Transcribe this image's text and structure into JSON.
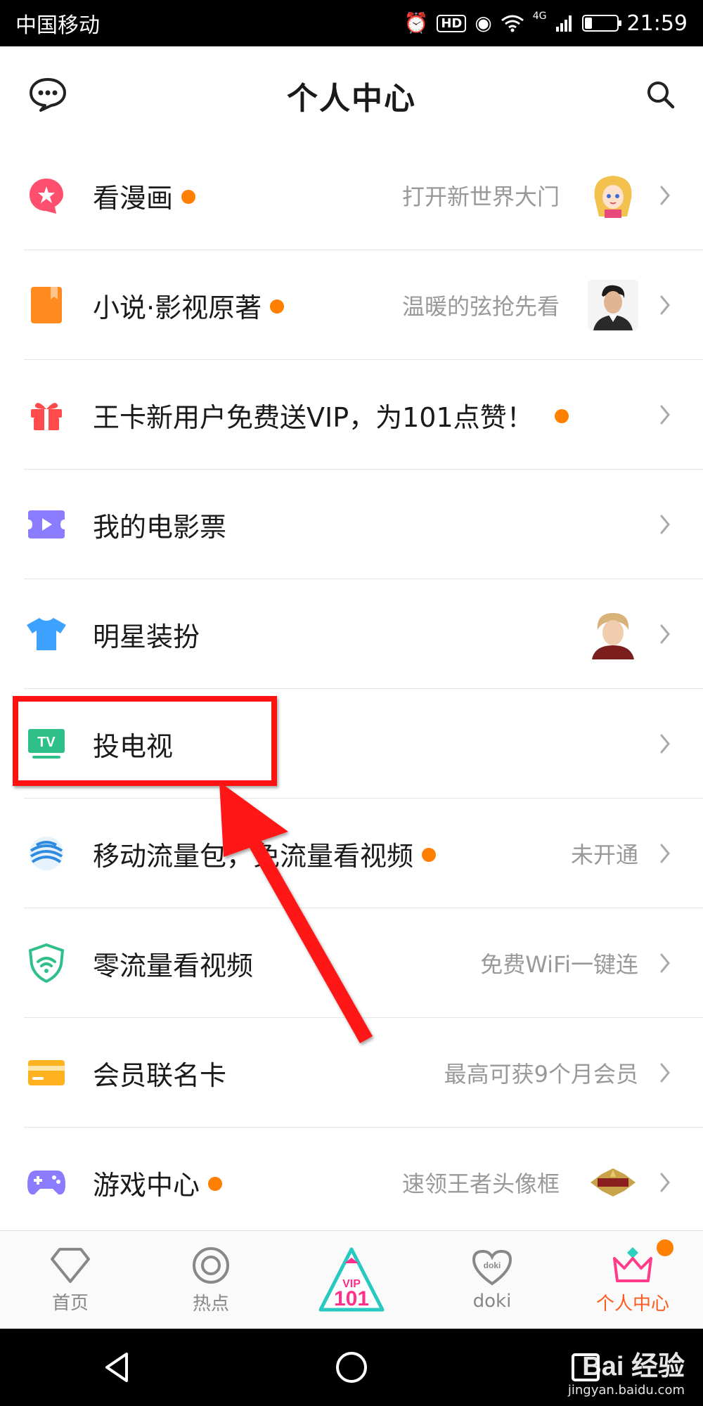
{
  "status_bar": {
    "carrier": "中国移动",
    "hd": "HD",
    "network": "4G",
    "time": "21:59"
  },
  "header": {
    "title": "个人中心",
    "left_icon": "message-icon",
    "right_icon": "search-icon"
  },
  "rows": [
    {
      "title": "看漫画",
      "dot": true,
      "subtitle": "打开新世界大门",
      "icon": "comic-icon",
      "icon_color": "#ff4f6e",
      "thumb": "anime-girl"
    },
    {
      "title": "小说·影视原著",
      "dot": true,
      "subtitle": "温暖的弦抢先看",
      "icon": "book-icon",
      "icon_color": "#ff8a1f",
      "thumb": "man-portrait"
    },
    {
      "title": "王卡新用户免费送VIP，为101点赞！",
      "dot": true,
      "subtitle": "",
      "icon": "gift-icon",
      "icon_color": "#ff4b4b"
    },
    {
      "title": "我的电影票",
      "dot": false,
      "subtitle": "",
      "icon": "ticket-icon",
      "icon_color": "#8b7bff"
    },
    {
      "title": "明星装扮",
      "dot": false,
      "subtitle": "",
      "icon": "tshirt-icon",
      "icon_color": "#3da2ff",
      "thumb": "star-portrait"
    },
    {
      "title": "投电视",
      "dot": false,
      "subtitle": "",
      "icon": "tv-icon",
      "icon_color": "#2fc08a",
      "icon_text": "TV"
    },
    {
      "title": "移动流量包，免流量看视频",
      "dot": true,
      "subtitle": "未开通",
      "icon": "china-mobile-icon",
      "icon_color": "#2f8be0"
    },
    {
      "title": "零流量看视频",
      "dot": false,
      "subtitle": "免费WiFi一键连",
      "icon": "wifi-shield-icon",
      "icon_color": "#2fc08a"
    },
    {
      "title": "会员联名卡",
      "dot": false,
      "subtitle": "最高可获9个月会员",
      "icon": "card-icon",
      "icon_color": "#ffb21f"
    },
    {
      "title": "游戏中心",
      "dot": true,
      "subtitle": "速领王者头像框",
      "icon": "gamepad-icon",
      "icon_color": "#8b7bff",
      "thumb": "game-logo"
    }
  ],
  "tabs": [
    {
      "label": "首页",
      "icon": "diamond-icon",
      "active": false
    },
    {
      "label": "热点",
      "icon": "target-icon",
      "active": false
    },
    {
      "label": "VIP 101",
      "icon": "vip101-icon",
      "active": false,
      "center": true
    },
    {
      "label": "doki",
      "icon": "doki-heart-icon",
      "active": false
    },
    {
      "label": "个人中心",
      "icon": "crown-icon",
      "active": true,
      "dot": true
    }
  ],
  "watermark": {
    "main": "Bai 经验",
    "sub": "jingyan.baidu.com"
  },
  "colors": {
    "accent_orange": "#ff7f00",
    "highlight_red": "#ff1212",
    "active_tab": "#ff5a1f"
  }
}
